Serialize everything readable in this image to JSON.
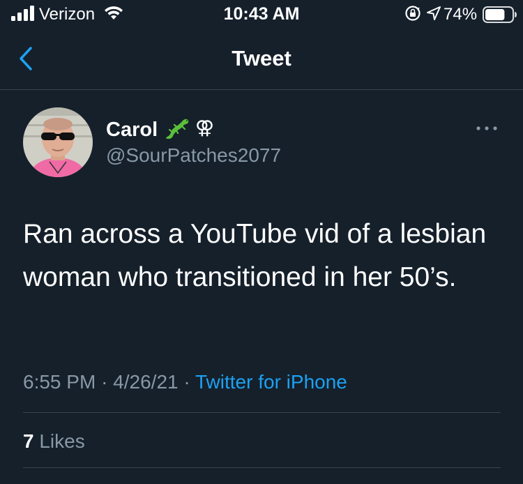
{
  "status_bar": {
    "carrier": "Verizon",
    "time": "10:43 AM",
    "battery_percent": "74%",
    "battery_level": 0.74,
    "icons": [
      "signal-icon",
      "wifi-icon",
      "rotation-lock-icon",
      "location-arrow-icon",
      "battery-icon"
    ]
  },
  "header": {
    "title": "Tweet",
    "back_icon": "chevron-left-icon"
  },
  "tweet": {
    "author_name": "Carol",
    "name_emoji": "lizard-icon",
    "name_symbol": "⚢",
    "handle": "@SourPatches2077",
    "text": "Ran across a YouTube vid of a lesbian woman who transitioned in her 50’s.",
    "time": "6:55 PM",
    "date": "4/26/21",
    "separator": "·",
    "source": "Twitter for iPhone",
    "likes_count": "7",
    "likes_label": "Likes"
  },
  "colors": {
    "background": "#15202b",
    "accent": "#1da1f2",
    "secondary_text": "#8899a6",
    "divider": "#38444d"
  }
}
